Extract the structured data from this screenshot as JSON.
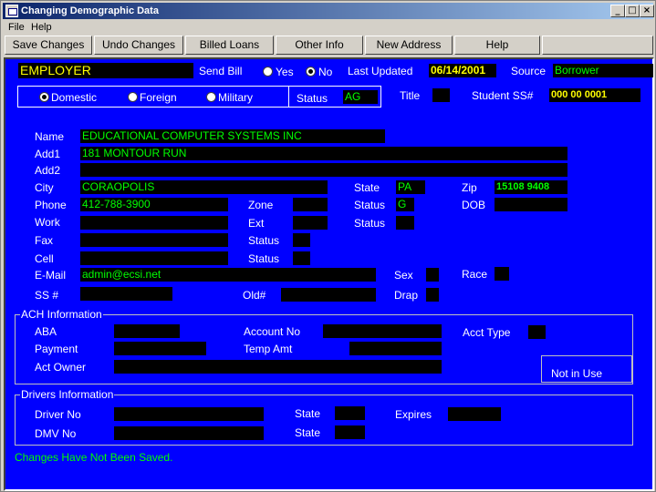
{
  "window": {
    "title": "Changing Demographic Data",
    "controls": {
      "minimize": "_",
      "maximize": "□",
      "close": "×"
    }
  },
  "menu": {
    "file": "File",
    "help": "Help"
  },
  "toolbar": {
    "save": "Save Changes",
    "undo": "Undo Changes",
    "billed": "Billed Loans",
    "other": "Other Info",
    "newaddr": "New Address",
    "help": "Help"
  },
  "header": {
    "type": "EMPLOYER",
    "send_bill_label": "Send Bill",
    "yes": "Yes",
    "no": "No",
    "send_bill_value": "No",
    "last_updated_label": "Last Updated",
    "last_updated": "06/14/2001",
    "source_label": "Source",
    "source": "Borrower"
  },
  "address_type": {
    "domestic": "Domestic",
    "foreign": "Foreign",
    "military": "Military",
    "selected": "Domestic",
    "status_label": "Status",
    "status": "AG"
  },
  "title_label": "Title",
  "title_value": "",
  "student_ss_label": "Student SS#",
  "student_ss": "000 00 0001",
  "labels": {
    "name": "Name",
    "add1": "Add1",
    "add2": "Add2",
    "city": "City",
    "state": "State",
    "zip": "Zip",
    "phone": "Phone",
    "zone": "Zone",
    "status": "Status",
    "dob": "DOB",
    "work": "Work",
    "ext": "Ext",
    "fax": "Fax",
    "cell": "Cell",
    "email": "E-Mail",
    "sex": "Sex",
    "race": "Race",
    "ss": "SS #",
    "old": "Old#",
    "drap": "Drap"
  },
  "fields": {
    "name": "EDUCATIONAL COMPUTER SYSTEMS INC",
    "add1": "181 MONTOUR RUN",
    "add2": "",
    "city": "CORAOPOLIS",
    "state": "PA",
    "zip": "15108  9408",
    "phone": "412-788-3900",
    "zone": "",
    "phone_status": "G",
    "dob": "",
    "work": "",
    "ext": "",
    "work_status": "",
    "fax": "",
    "fax_status": "",
    "cell": "",
    "cell_status": "",
    "email": "admin@ecsi.net",
    "sex": "",
    "race": "",
    "ss": "",
    "old": "",
    "drap": ""
  },
  "ach": {
    "title": "ACH Information",
    "aba_label": "ABA",
    "aba": "",
    "account_label": "Account No",
    "account": "",
    "acct_type_label": "Acct Type",
    "acct_type": "",
    "payment_label": "Payment",
    "payment": "",
    "temp_label": "Temp Amt",
    "temp": "",
    "owner_label": "Act Owner",
    "owner": "",
    "in_use": "Not in Use"
  },
  "drivers": {
    "title": "Drivers Information",
    "driver_label": "Driver No",
    "driver": "",
    "state_label": "State",
    "state": "",
    "expires_label": "Expires",
    "expires": "",
    "dmv_label": "DMV No",
    "dmv": "",
    "dmv_state_label": "State",
    "dmv_state": ""
  },
  "status_message": "Changes Have Not Been Saved.",
  "colors": {
    "panel": "#0000ff",
    "field": "#000000",
    "green": "#00ff00",
    "yellow": "#ffff00"
  }
}
